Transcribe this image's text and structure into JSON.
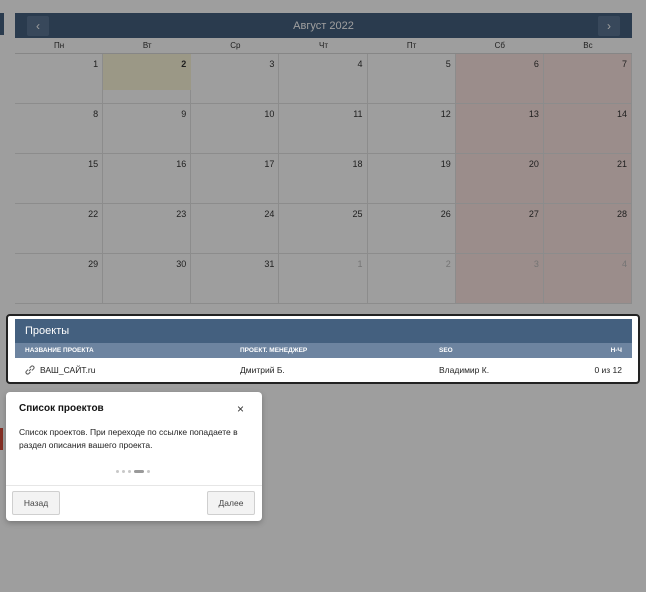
{
  "calendar": {
    "month_title": "Август 2022",
    "prev_label": "‹",
    "next_label": "›",
    "weekdays": [
      "Пн",
      "Вт",
      "Ср",
      "Чт",
      "Пт",
      "Сб",
      "Вс"
    ],
    "weeks": [
      [
        "1",
        "2",
        "3",
        "4",
        "5",
        "6",
        "7"
      ],
      [
        "8",
        "9",
        "10",
        "11",
        "12",
        "13",
        "14"
      ],
      [
        "15",
        "16",
        "17",
        "18",
        "19",
        "20",
        "21"
      ],
      [
        "22",
        "23",
        "24",
        "25",
        "26",
        "27",
        "28"
      ],
      [
        "29",
        "30",
        "31",
        "1",
        "2",
        "3",
        "4"
      ]
    ],
    "today": "2"
  },
  "projects": {
    "title": "Проекты",
    "columns": [
      "НАЗВАНИЕ ПРОЕКТА",
      "ПРОЕКТ. МЕНЕДЖЕР",
      "SEO",
      "Н-Ч"
    ],
    "rows": [
      {
        "name": "ВАШ_САЙТ.ru",
        "manager": "Дмитрий Б.",
        "seo": "Владимир К.",
        "hours": "0 из 12",
        "icon": "link-icon"
      }
    ]
  },
  "tour_popup": {
    "title": "Список проектов",
    "close_label": "×",
    "text": "Список проектов. При переходе по ссылке попадаете в раздел описания вашего проекта.",
    "back_label": "Назад",
    "next_label": "Далее",
    "step_count": 4,
    "current_step": 3
  },
  "colors": {
    "header": "#44607f",
    "subheader": "#6d84a0",
    "weekend": "#fbe4e0",
    "today": "#fbf5d8"
  }
}
